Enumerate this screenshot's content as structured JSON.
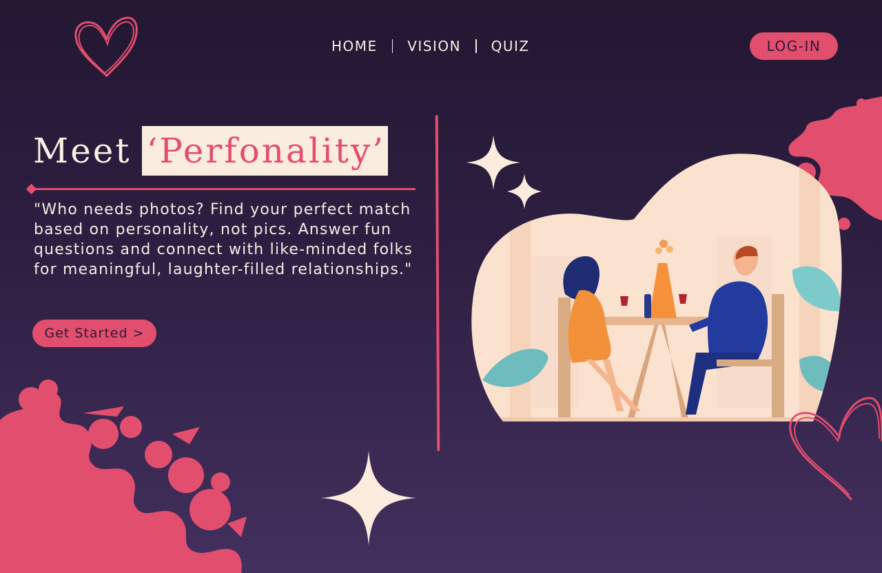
{
  "header": {
    "nav": [
      {
        "label": "HOME"
      },
      {
        "label": "VISION"
      },
      {
        "label": "QUIZ"
      }
    ],
    "login_label": "LOG-IN"
  },
  "hero": {
    "headline_prefix": "Meet",
    "headline_brand": "‘Perfonality’",
    "tagline": "\"Who needs photos? Find your perfect match based on personality, not pics. Answer fun questions and connect with like-minded folks for meaningful, laughter-filled relationships.\"",
    "cta_label": "Get Started >"
  },
  "icons": {
    "logo": "heart-outline-icon",
    "sparkles": "sparkle-icon",
    "illustration": "couple-dinner-illustration"
  },
  "colors": {
    "accent": "#e24e6e",
    "cream": "#fbece0",
    "bg_top": "#231732",
    "bg_bottom": "#43305e"
  }
}
